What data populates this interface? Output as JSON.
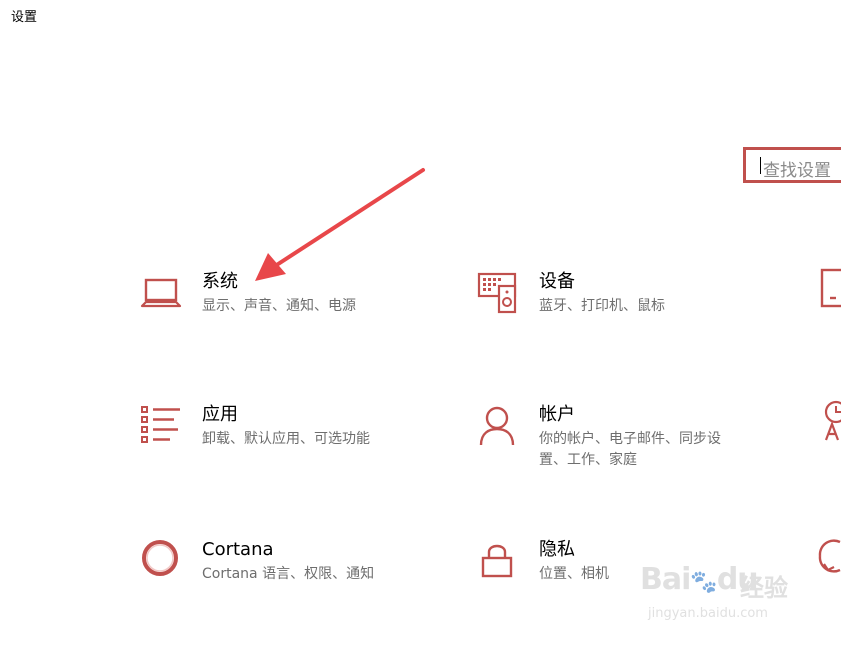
{
  "window": {
    "title": "设置"
  },
  "search": {
    "placeholder": "查找设置"
  },
  "tiles": [
    {
      "title": "系统",
      "desc": "显示、声音、通知、电源",
      "icon": "laptop-icon"
    },
    {
      "title": "设备",
      "desc": "蓝牙、打印机、鼠标",
      "icon": "devices-icon"
    },
    {
      "title": "应用",
      "desc": "卸载、默认应用、可选功能",
      "icon": "apps-list-icon"
    },
    {
      "title": "帐户",
      "desc": "你的帐户、电子邮件、同步设置、工作、家庭",
      "icon": "person-icon"
    },
    {
      "title": "Cortana",
      "desc": "Cortana 语言、权限、通知",
      "icon": "cortana-circle-icon"
    },
    {
      "title": "隐私",
      "desc": "位置、相机",
      "icon": "lock-icon"
    }
  ],
  "watermark": {
    "logo": "Bai",
    "logo2": "du",
    "cn": "经验",
    "url": "jingyan.baidu.com"
  },
  "colors": {
    "accent": "#c0504d",
    "arrow": "#e8474a"
  }
}
